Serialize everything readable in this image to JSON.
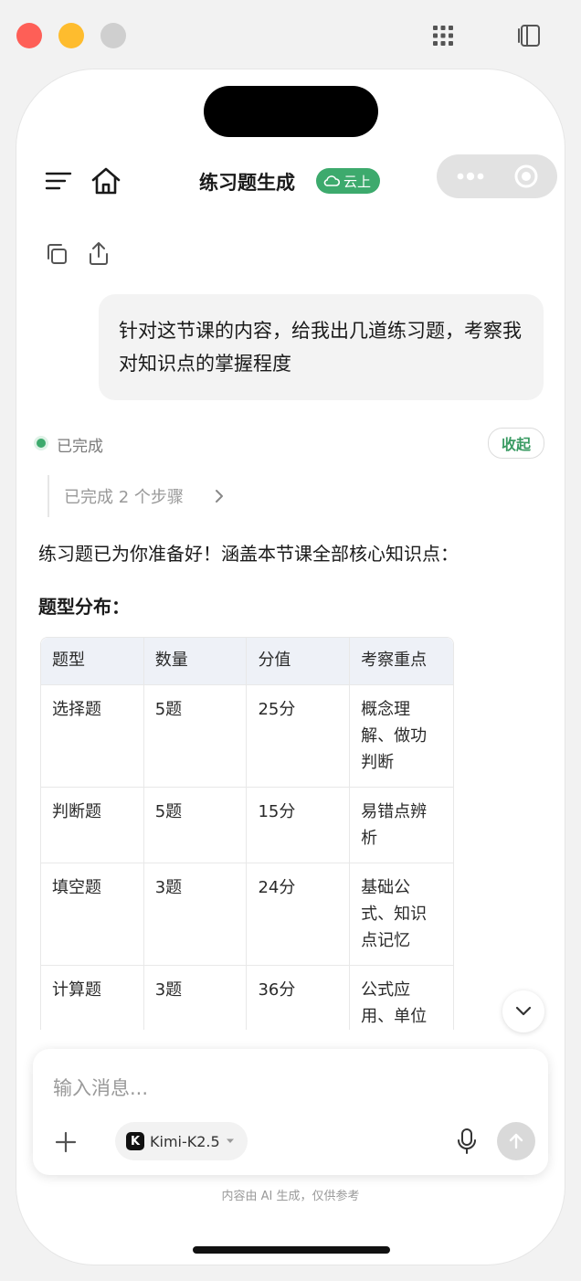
{
  "header": {
    "title": "练习题生成",
    "badge": "云上"
  },
  "user_message": {
    "text": "针对这节课的内容，给我出几道练习题，考察我对知识点的掌握程度"
  },
  "ai_status": {
    "status": "已完成",
    "collapse_label": "收起",
    "steps_label": "已完成 2 个步骤"
  },
  "ai_message": {
    "intro": "练习题已为你准备好！涵盖本节课全部核心知识点：",
    "section_title": "题型分布："
  },
  "table": {
    "headers": [
      "题型",
      "数量",
      "分值",
      "考察重点"
    ],
    "rows": [
      [
        "选择题",
        "5题",
        "25分",
        "概念理解、做功判断"
      ],
      [
        "判断题",
        "5题",
        "15分",
        "易错点辨析"
      ],
      [
        "填空题",
        "3题",
        "24分",
        "基础公式、知识点记忆"
      ],
      [
        "计算题",
        "3题",
        "36分",
        "公式应用、单位换算"
      ]
    ]
  },
  "composer": {
    "placeholder": "输入消息...",
    "model_name": "Kimi-K2.5",
    "model_logo": "K"
  },
  "footer": {
    "disclaimer": "内容由 AI 生成，仅供参考"
  },
  "colors": {
    "accent_green": "#3daa6d",
    "table_header_bg": "#eef1f7"
  },
  "icons": {
    "menu": "menu-icon",
    "home": "home-icon",
    "cloud": "cloud-icon",
    "copy": "copy-icon",
    "share": "share-icon",
    "chevron_right": "chevron-right-icon",
    "chevron_down": "chevron-down-icon",
    "plus": "plus-icon",
    "mic": "microphone-icon",
    "send": "arrow-up-icon"
  }
}
